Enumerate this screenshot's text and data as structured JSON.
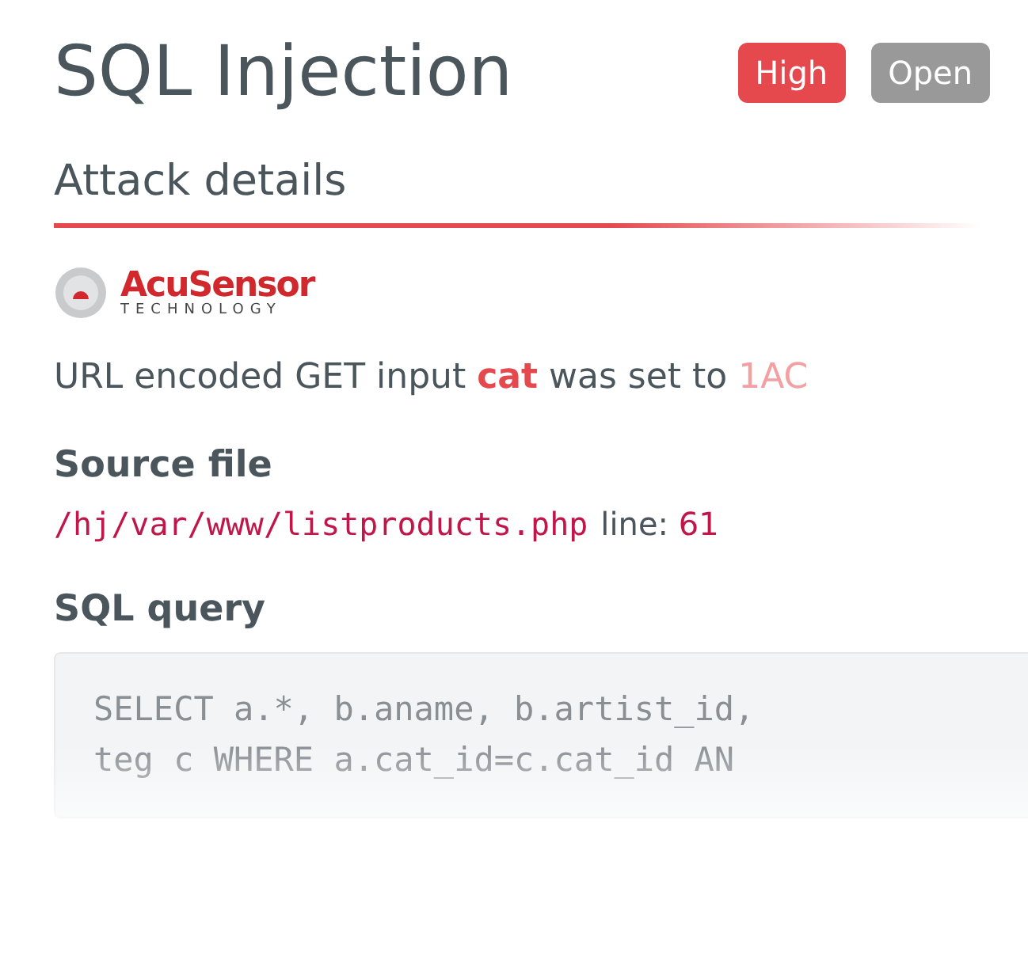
{
  "title": "SQL Injection",
  "badges": [
    {
      "label": "High",
      "color": "#e5484d"
    },
    {
      "label": "Open",
      "color": "#999999"
    }
  ],
  "section_heading": "Attack details",
  "logo": {
    "name": "AcuSensor",
    "tagline": "TECHNOLOGY"
  },
  "message": [
    {
      "kind": "plain",
      "text": "URL encoded GET input "
    },
    {
      "kind": "param",
      "text": "cat"
    },
    {
      "kind": "plain",
      "text": " was set to "
    },
    {
      "kind": "value",
      "text": "1AC"
    }
  ],
  "source_file": {
    "label": "Source file",
    "path": "/hj/var/www/listproducts.php",
    "line_label": "line:",
    "line": "61"
  },
  "sql_query": {
    "label": "SQL query",
    "lines": [
      "SELECT a.*, b.aname, b.artist_id,",
      "teg c WHERE a.cat_id=c.cat_id AN"
    ]
  }
}
